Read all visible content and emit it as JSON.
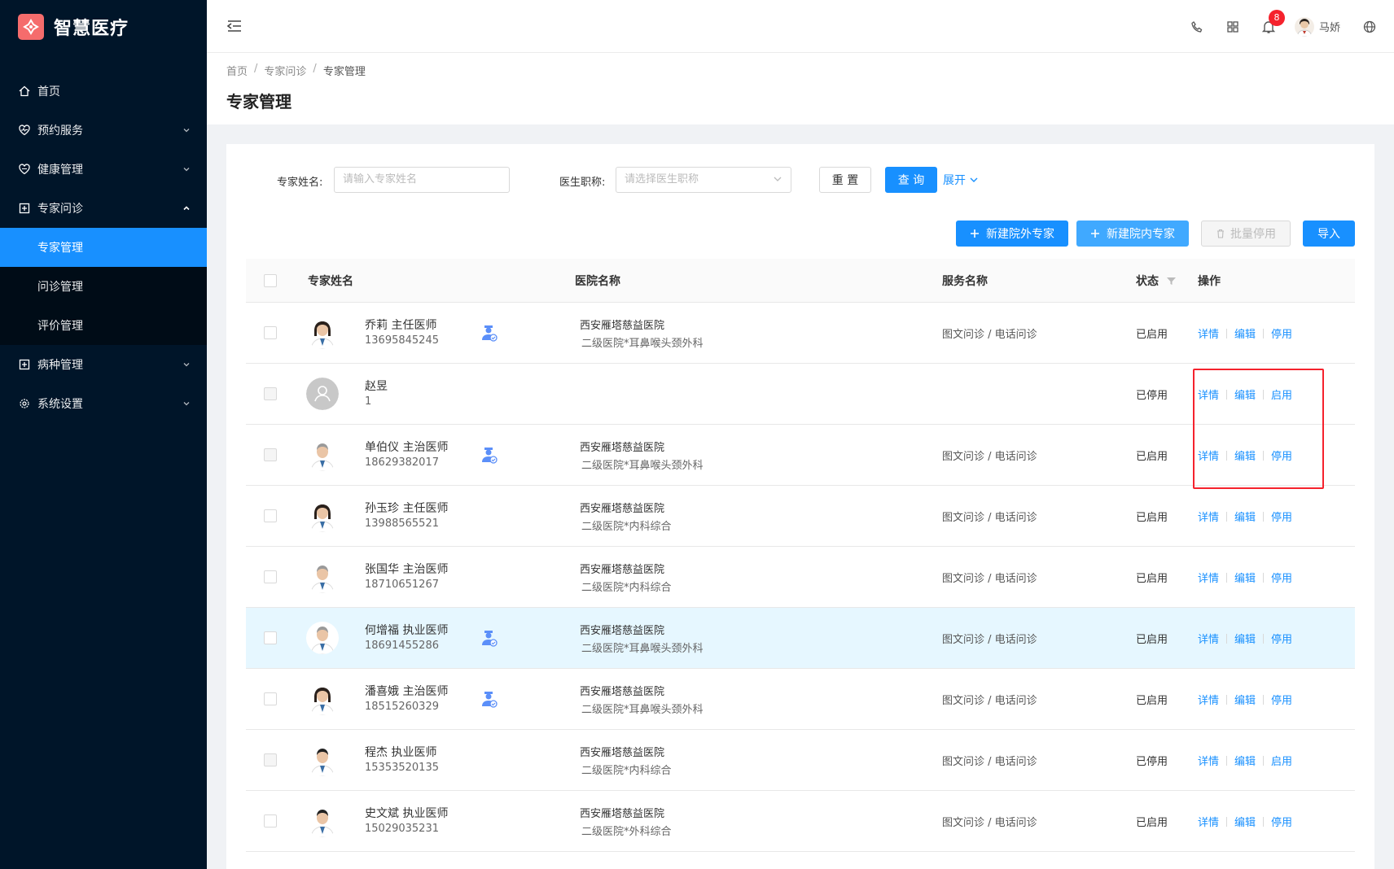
{
  "app": {
    "title": "智慧医疗"
  },
  "sidebar": {
    "items": [
      {
        "label": "首页",
        "icon": "home-icon"
      },
      {
        "label": "预约服务",
        "icon": "heart-icon"
      },
      {
        "label": "健康管理",
        "icon": "heart-pulse-icon"
      },
      {
        "label": "专家问诊",
        "icon": "plus-square-icon",
        "expanded": true,
        "children": [
          {
            "label": "专家管理",
            "active": true
          },
          {
            "label": "问诊管理"
          },
          {
            "label": "评价管理"
          }
        ]
      },
      {
        "label": "病种管理",
        "icon": "plus-square-icon"
      },
      {
        "label": "系统设置",
        "icon": "settings-icon"
      }
    ]
  },
  "header": {
    "badge_count": "8",
    "user_name": "马娇"
  },
  "breadcrumb": [
    "首页",
    "专家问诊",
    "专家管理"
  ],
  "page_title": "专家管理",
  "filter": {
    "name_label": "专家姓名:",
    "name_placeholder": "请输入专家姓名",
    "title_label": "医生职称:",
    "title_placeholder": "请选择医生职称",
    "reset_label": "重 置",
    "query_label": "查 询",
    "expand_label": "展开"
  },
  "toolbar": {
    "add_external": "新建院外专家",
    "add_internal": "新建院内专家",
    "batch_disable": "批量停用",
    "import": "导入"
  },
  "table": {
    "columns": [
      "专家姓名",
      "医院名称",
      "服务名称",
      "状态",
      "操作"
    ],
    "op_detail": "详情",
    "op_edit": "编辑",
    "rows": [
      {
        "name": "乔莉 主任医师",
        "phone": "13695845245",
        "inner": true,
        "hospital": "西安雁塔慈益医院",
        "dept": "二级医院*耳鼻喉头颈外科",
        "service": "图文问诊 / 电话问诊",
        "status": "已启用",
        "toggle": "停用",
        "avatar": "female"
      },
      {
        "name": "赵昱",
        "phone": "1",
        "inner": false,
        "hospital": "",
        "dept": "",
        "service": "",
        "status": "已停用",
        "toggle": "启用",
        "avatar": "placeholder",
        "disabled_cb": true
      },
      {
        "name": "单伯仪 主治医师",
        "phone": "18629382017",
        "inner": true,
        "hospital": "西安雁塔慈益医院",
        "dept": "二级医院*耳鼻喉头颈外科",
        "service": "图文问诊 / 电话问诊",
        "status": "已启用",
        "toggle": "停用",
        "avatar": "male-old",
        "disabled_cb": true
      },
      {
        "name": "孙玉珍 主任医师",
        "phone": "13988565521",
        "inner": false,
        "hospital": "西安雁塔慈益医院",
        "dept": "二级医院*内科综合",
        "service": "图文问诊 / 电话问诊",
        "status": "已启用",
        "toggle": "停用",
        "avatar": "female-old"
      },
      {
        "name": "张国华 主治医师",
        "phone": "18710651267",
        "inner": false,
        "hospital": "西安雁塔慈益医院",
        "dept": "二级医院*内科综合",
        "service": "图文问诊 / 电话问诊",
        "status": "已启用",
        "toggle": "停用",
        "avatar": "male-old"
      },
      {
        "name": "何增福 执业医师",
        "phone": "18691455286",
        "inner": true,
        "hospital": "西安雁塔慈益医院",
        "dept": "二级医院*耳鼻喉头颈外科",
        "service": "图文问诊 / 电话问诊",
        "status": "已启用",
        "toggle": "停用",
        "avatar": "male-old",
        "highlight": true
      },
      {
        "name": "潘喜娥 主治医师",
        "phone": "18515260329",
        "inner": true,
        "hospital": "西安雁塔慈益医院",
        "dept": "二级医院*耳鼻喉头颈外科",
        "service": "图文问诊 / 电话问诊",
        "status": "已启用",
        "toggle": "停用",
        "avatar": "female"
      },
      {
        "name": "程杰 执业医师",
        "phone": "15353520135",
        "inner": false,
        "hospital": "西安雁塔慈益医院",
        "dept": "二级医院*内科综合",
        "service": "图文问诊 / 电话问诊",
        "status": "已停用",
        "toggle": "启用",
        "avatar": "male",
        "disabled_cb": true
      },
      {
        "name": "史文斌 执业医师",
        "phone": "15029035231",
        "inner": false,
        "hospital": "西安雁塔慈益医院",
        "dept": "二级医院*外科综合",
        "service": "图文问诊 / 电话问诊",
        "status": "已启用",
        "toggle": "停用",
        "avatar": "male"
      }
    ]
  },
  "colors": {
    "sidebar_bg": "#001529",
    "primary": "#1890ff",
    "highlight_box": "#f5222d",
    "logo": "#f56c6c"
  }
}
